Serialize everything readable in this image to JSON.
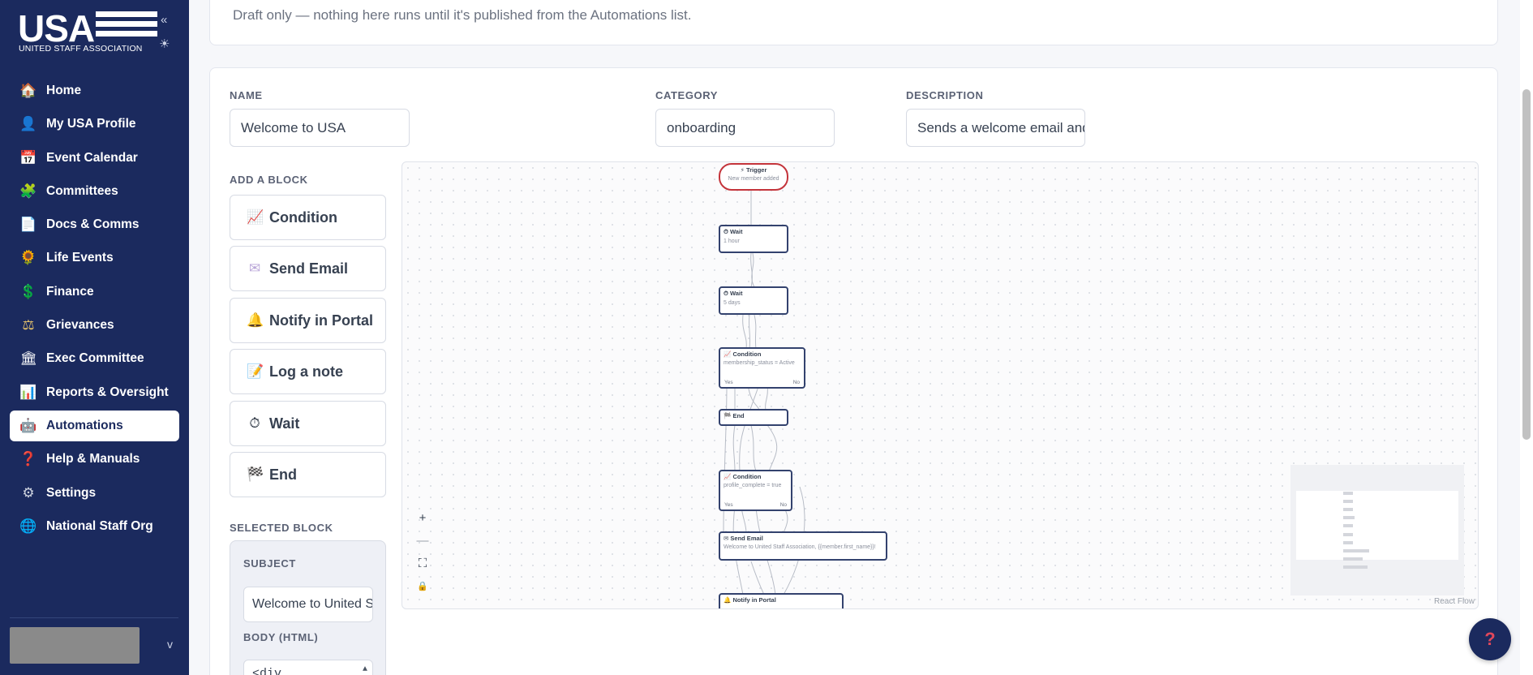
{
  "sidebar": {
    "logo_text": "USA",
    "logo_subtitle": "UNITED STAFF ASSOCIATION",
    "collapse_icon": "«",
    "theme_icon": "☀",
    "items": [
      {
        "label": "Home",
        "icon": "🏠",
        "active": false
      },
      {
        "label": "My USA Profile",
        "icon": "👤",
        "active": false
      },
      {
        "label": "Event Calendar",
        "icon": "📅",
        "active": false
      },
      {
        "label": "Committees",
        "icon": "🧩",
        "active": false
      },
      {
        "label": "Docs & Comms",
        "icon": "📄",
        "active": false
      },
      {
        "label": "Life Events",
        "icon": "🌻",
        "active": false
      },
      {
        "label": "Finance",
        "icon": "💲",
        "active": false
      },
      {
        "label": "Grievances",
        "icon": "⚖",
        "active": false
      },
      {
        "label": "Exec Committee",
        "icon": "🏛",
        "active": false
      },
      {
        "label": "Reports & Oversight",
        "icon": "📊",
        "active": false
      },
      {
        "label": "Automations",
        "icon": "🤖",
        "active": true
      },
      {
        "label": "Help & Manuals",
        "icon": "❓",
        "active": false
      },
      {
        "label": "Settings",
        "icon": "⚙",
        "active": false
      },
      {
        "label": "National Staff Org",
        "icon": "🌐",
        "active": false
      }
    ],
    "user_chevron": "v"
  },
  "notice": {
    "text": "Draft only — nothing here runs until it's published from the Automations list."
  },
  "form": {
    "name_label": "NAME",
    "name_value": "Welcome to USA",
    "category_label": "CATEGORY",
    "category_value": "onboarding",
    "description_label": "DESCRIPTION",
    "description_value": "Sends a welcome email and"
  },
  "blocks": {
    "title": "ADD A BLOCK",
    "items": [
      {
        "label": "Condition",
        "icon": "📈"
      },
      {
        "label": "Send Email",
        "icon": "✉"
      },
      {
        "label": "Notify in Portal",
        "icon": "🔔"
      },
      {
        "label": "Log a note",
        "icon": "📝"
      },
      {
        "label": "Wait",
        "icon": "⏱"
      },
      {
        "label": "End",
        "icon": "🏁"
      }
    ]
  },
  "selected": {
    "title": "SELECTED BLOCK",
    "subject_label": "SUBJECT",
    "subject_value": "Welcome to United Staff Association",
    "body_label": "BODY (HTML)",
    "body_value": "<div"
  },
  "flow": {
    "nodes": [
      {
        "title": "Trigger",
        "icon": "⚡",
        "sub": "New member added"
      },
      {
        "title": "Wait",
        "icon": "⏱",
        "sub": "1 hour"
      },
      {
        "title": "Wait",
        "icon": "⏱",
        "sub": "5 days"
      },
      {
        "title": "Condition",
        "icon": "📈",
        "sub": "membership_status = Active",
        "yes": "Yes",
        "no": "No"
      },
      {
        "title": "End",
        "icon": "🏁"
      },
      {
        "title": "Condition",
        "icon": "📈",
        "sub": "profile_complete = true",
        "yes": "Yes",
        "no": "No"
      },
      {
        "title": "Send Email",
        "icon": "✉",
        "sub": "Welcome to United Staff Association, {{member.first_name}}!"
      },
      {
        "title": "Notify in Portal",
        "icon": "🔔"
      }
    ],
    "controls": {
      "zoom_in": "+",
      "zoom_out": "—",
      "fit": "⛶",
      "lock": "🔒"
    },
    "attribution": "React Flow"
  },
  "help_button": "?",
  "colors": {
    "sidebar_bg": "#1b2a5e",
    "trigger_border": "#c4343b",
    "node_border": "#33426e",
    "help_accent": "#e0475b"
  }
}
